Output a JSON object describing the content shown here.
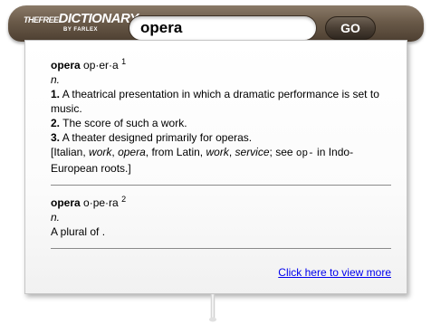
{
  "header": {
    "logo_the": "THE",
    "logo_free": "FREE",
    "logo_dictionary": "DICTIONARY",
    "logo_by": "BY FARLEX",
    "search_value": "opera",
    "go_label": "GO"
  },
  "entries": [
    {
      "headword": "opera",
      "pronunciation": "op·er·a",
      "homograph": "1",
      "pos": "n.",
      "senses": [
        {
          "num": "1.",
          "text": "A theatrical presentation in which a dramatic performance is set to music."
        },
        {
          "num": "2.",
          "text": "The score of such a work."
        },
        {
          "num": "3.",
          "text": "A theater designed primarily for operas."
        }
      ],
      "etymology": {
        "open": "[Italian,",
        "w1": "work",
        "sep1": ",",
        "w2": "opera",
        "mid": ", from Latin,",
        "w3": "work",
        "sep2": ",",
        "w4": "service",
        "see": "; see",
        "root": "op-",
        "tail": "in Indo-European roots.]"
      }
    },
    {
      "headword": "opera",
      "pronunciation": "o·pe·ra",
      "homograph": "2",
      "pos": "n.",
      "definition": "A plural of ."
    }
  ],
  "footer": {
    "more_link": "Click here to view more"
  },
  "colors": {
    "header_brown": "#6a5a49",
    "link_blue": "#0000ee"
  }
}
